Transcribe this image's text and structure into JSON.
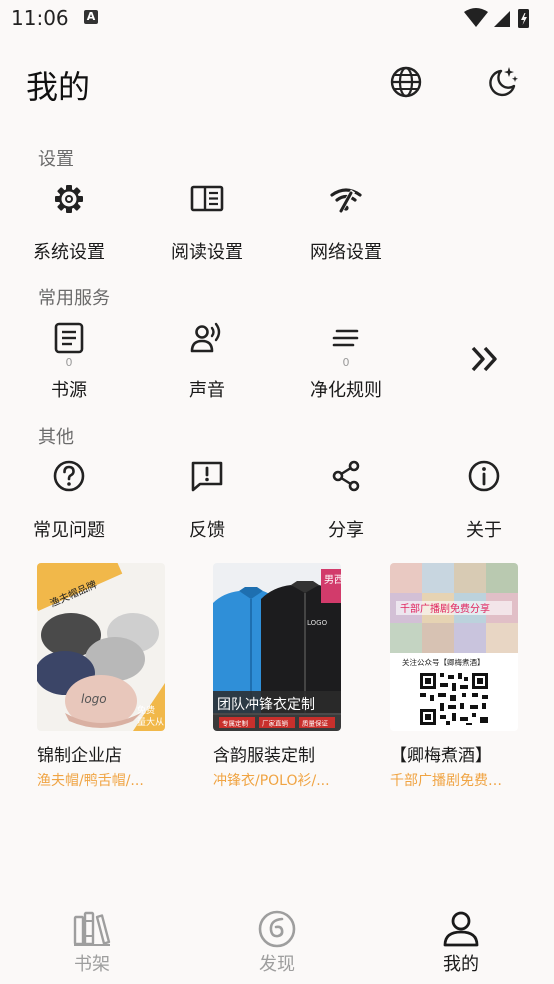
{
  "status": {
    "time": "11:06",
    "a_badge": "A"
  },
  "header": {
    "title": "我的"
  },
  "sections": {
    "settings": {
      "label": "设置",
      "items": [
        {
          "label": "系统设置"
        },
        {
          "label": "阅读设置"
        },
        {
          "label": "网络设置"
        }
      ]
    },
    "services": {
      "label": "常用服务",
      "items": [
        {
          "label": "书源",
          "count": "0"
        },
        {
          "label": "声音"
        },
        {
          "label": "净化规则",
          "count": "0"
        }
      ]
    },
    "others": {
      "label": "其他",
      "items": [
        {
          "label": "常见问题"
        },
        {
          "label": "反馈"
        },
        {
          "label": "分享"
        },
        {
          "label": "关于"
        }
      ]
    }
  },
  "ads": [
    {
      "title": "锦制企业店",
      "subtitle": "渔夫帽/鸭舌帽/..."
    },
    {
      "title": "含韵服装定制",
      "subtitle": "冲锋衣/POLO衫/..."
    },
    {
      "title": "【卿梅煮酒】",
      "subtitle": "千部广播剧免费…"
    }
  ],
  "ad_images": {
    "ad1": {
      "banner": "渔夫帽品牌",
      "logo": "logo",
      "side1": "免费",
      "side2": "量大从"
    },
    "ad2": {
      "corner": "男西",
      "logo": "LOGO",
      "banner": "团队冲锋衣定制",
      "tag1": "专属定制",
      "tag2": "厂家直销",
      "tag3": "质量保证"
    },
    "ad3": {
      "banner": "千部广播剧免费分享",
      "follow": "关注公众号【卿梅煮酒】"
    }
  },
  "bottom_nav": {
    "items": [
      {
        "label": "书架"
      },
      {
        "label": "发现"
      },
      {
        "label": "我的"
      }
    ]
  },
  "colors": {
    "accent": "#f0a443",
    "active": "#1a1a1a",
    "inactive": "#9e9e9e",
    "background": "#fbf9f8"
  }
}
